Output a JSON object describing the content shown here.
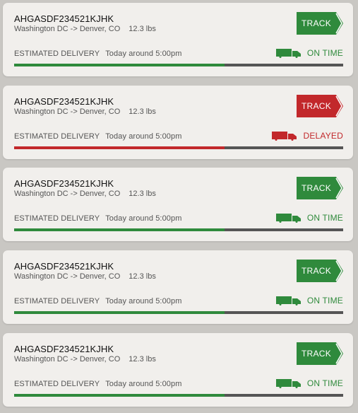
{
  "colors": {
    "on_time": "#2f8a3c",
    "delayed": "#c2282b",
    "track_remaining": "#555555",
    "card_bg": "#f1efec",
    "page_bg": "#c9c7c3"
  },
  "estimated_label": "ESTIMATED DELIVERY",
  "track_label": "TRACK",
  "icons": {
    "truck": "truck-icon",
    "track_arrow": "arrow-right-icon"
  },
  "shipments": [
    {
      "tracking_id": "AHGASDF234521KJHK",
      "route": "Washington DC -> Denver, CO",
      "weight": "12.3 lbs",
      "estimated_delivery": "Today around 5:00pm",
      "status": "ON TIME",
      "status_type": "on_time",
      "progress": 0.64
    },
    {
      "tracking_id": "AHGASDF234521KJHK",
      "route": "Washington DC -> Denver, CO",
      "weight": "12.3 lbs",
      "estimated_delivery": "Today around 5:00pm",
      "status": "DELAYED",
      "status_type": "delayed",
      "progress": 0.64
    },
    {
      "tracking_id": "AHGASDF234521KJHK",
      "route": "Washington DC -> Denver, CO",
      "weight": "12.3 lbs",
      "estimated_delivery": "Today around 5:00pm",
      "status": "ON TIME",
      "status_type": "on_time",
      "progress": 0.64
    },
    {
      "tracking_id": "AHGASDF234521KJHK",
      "route": "Washington DC -> Denver, CO",
      "weight": "12.3 lbs",
      "estimated_delivery": "Today around 5:00pm",
      "status": "ON TIME",
      "status_type": "on_time",
      "progress": 0.64
    },
    {
      "tracking_id": "AHGASDF234521KJHK",
      "route": "Washington DC -> Denver, CO",
      "weight": "12.3 lbs",
      "estimated_delivery": "Today around 5:00pm",
      "status": "ON TIME",
      "status_type": "on_time",
      "progress": 0.64
    }
  ]
}
